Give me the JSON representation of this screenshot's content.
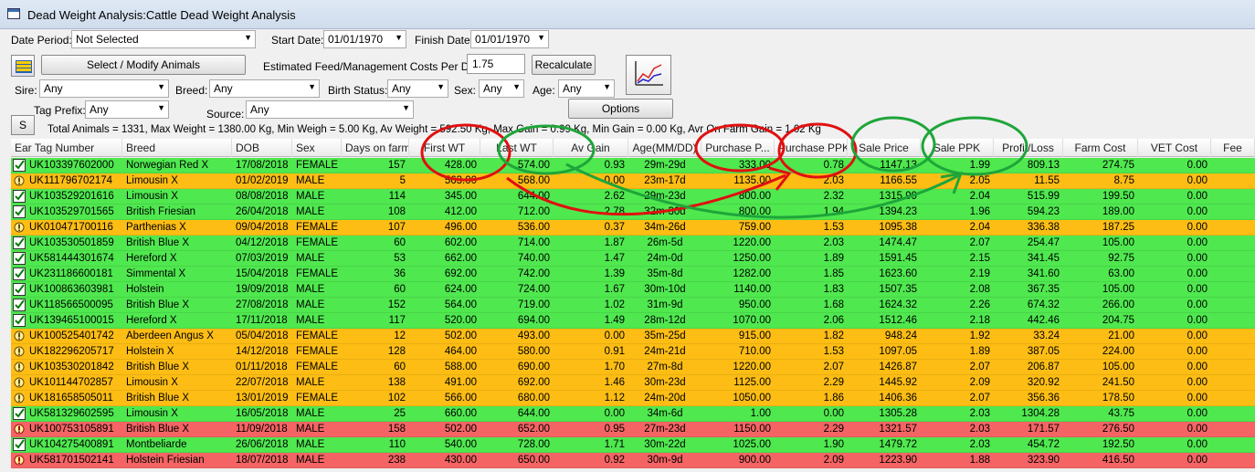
{
  "window": {
    "title": "Dead Weight Analysis:Cattle Dead Weight Analysis"
  },
  "filters": {
    "date_period_label": "Date Period:",
    "date_period": "Not Selected",
    "start_date_label": "Start Date:",
    "start_date": "01/01/1970",
    "finish_date_label": "Finish Date:",
    "finish_date": "01/01/1970",
    "select_animals_button": "Select / Modify Animals",
    "feed_cost_label": "Estimated Feed/Management Costs Per Day:",
    "feed_cost": "1.75",
    "recalculate_button": "Recalculate",
    "sire_label": "Sire:",
    "sire": "Any",
    "breed_label": "Breed:",
    "breed": "Any",
    "birth_status_label": "Birth Status:",
    "birth_status": "Any",
    "sex_label": "Sex:",
    "sex": "Any",
    "age_label": "Age:",
    "age": "Any",
    "tag_prefix_label": "Tag Prefix:",
    "tag_prefix": "Any",
    "source_label": "Source:",
    "source": "Any",
    "options_button": "Options",
    "s_button": "S"
  },
  "summary": "Total Animals = 1331, Max Weight = 1380.00 Kg, Min Weigh = 5.00 Kg, Av Weight = 592.50 Kg, Max Gain = 0.99 Kg, Min Gain = 0.00 Kg, Avr On Farm Gain = 1.02 Kg",
  "columns": [
    "Ear Tag Number",
    "Breed",
    "DOB",
    "Sex",
    "Days on farm",
    "First WT",
    "Last WT",
    "Av Gain",
    "Age(MM/DD)",
    "Purchase P...",
    "Purchase PPK",
    "Sale Price",
    "Sale PPK",
    "Profit/Loss",
    "Farm Cost",
    "VET Cost",
    "Fee"
  ],
  "colors": {
    "green": "#4fe84f",
    "orange": "#fdbd14",
    "red": "#f46464",
    "annotation_red": "#e01010",
    "annotation_green": "#1ea53a"
  },
  "rows": [
    {
      "status": "green",
      "tag": "UK103397602000",
      "breed": "Norwegian Red X",
      "dob": "17/08/2018",
      "sex": "FEMALE",
      "days": "157",
      "first": "428.00",
      "last": "574.00",
      "gain": "0.93",
      "age": "29m-29d",
      "pp": "333.00",
      "pppk": "0.78",
      "sp": "1147.13",
      "sppk": "1.99",
      "pl": "809.13",
      "farm": "274.75",
      "vet": "0.00"
    },
    {
      "status": "orange",
      "tag": "UK111796702174",
      "breed": "Limousin X",
      "dob": "01/02/2019",
      "sex": "MALE",
      "days": "5",
      "first": "563.00",
      "last": "568.00",
      "gain": "0.00",
      "age": "23m-17d",
      "pp": "1135.00",
      "pppk": "2.03",
      "sp": "1166.55",
      "sppk": "2.05",
      "pl": "11.55",
      "farm": "8.75",
      "vet": "0.00"
    },
    {
      "status": "green",
      "tag": "UK103529201616",
      "breed": "Limousin X",
      "dob": "08/08/2018",
      "sex": "MALE",
      "days": "114",
      "first": "345.00",
      "last": "644.00",
      "gain": "2.62",
      "age": "29m-23d",
      "pp": "800.00",
      "pppk": "2.32",
      "sp": "1315.99",
      "sppk": "2.04",
      "pl": "515.99",
      "farm": "199.50",
      "vet": "0.00"
    },
    {
      "status": "green",
      "tag": "UK103529701565",
      "breed": "British Friesian",
      "dob": "26/04/2018",
      "sex": "MALE",
      "days": "108",
      "first": "412.00",
      "last": "712.00",
      "gain": "2.78",
      "age": "32m-30d",
      "pp": "800.00",
      "pppk": "1.94",
      "sp": "1394.23",
      "sppk": "1.96",
      "pl": "594.23",
      "farm": "189.00",
      "vet": "0.00"
    },
    {
      "status": "orange",
      "tag": "UK010471700116",
      "breed": "Parthenias X",
      "dob": "09/04/2018",
      "sex": "FEMALE",
      "days": "107",
      "first": "496.00",
      "last": "536.00",
      "gain": "0.37",
      "age": "34m-26d",
      "pp": "759.00",
      "pppk": "1.53",
      "sp": "1095.38",
      "sppk": "2.04",
      "pl": "336.38",
      "farm": "187.25",
      "vet": "0.00"
    },
    {
      "status": "green",
      "tag": "UK103530501859",
      "breed": "British Blue X",
      "dob": "04/12/2018",
      "sex": "FEMALE",
      "days": "60",
      "first": "602.00",
      "last": "714.00",
      "gain": "1.87",
      "age": "26m-5d",
      "pp": "1220.00",
      "pppk": "2.03",
      "sp": "1474.47",
      "sppk": "2.07",
      "pl": "254.47",
      "farm": "105.00",
      "vet": "0.00"
    },
    {
      "status": "green",
      "tag": "UK581444301674",
      "breed": "Hereford X",
      "dob": "07/03/2019",
      "sex": "MALE",
      "days": "53",
      "first": "662.00",
      "last": "740.00",
      "gain": "1.47",
      "age": "24m-0d",
      "pp": "1250.00",
      "pppk": "1.89",
      "sp": "1591.45",
      "sppk": "2.15",
      "pl": "341.45",
      "farm": "92.75",
      "vet": "0.00"
    },
    {
      "status": "green",
      "tag": "UK231186600181",
      "breed": "Simmental X",
      "dob": "15/04/2018",
      "sex": "FEMALE",
      "days": "36",
      "first": "692.00",
      "last": "742.00",
      "gain": "1.39",
      "age": "35m-8d",
      "pp": "1282.00",
      "pppk": "1.85",
      "sp": "1623.60",
      "sppk": "2.19",
      "pl": "341.60",
      "farm": "63.00",
      "vet": "0.00"
    },
    {
      "status": "green",
      "tag": "UK100863603981",
      "breed": "Holstein",
      "dob": "19/09/2018",
      "sex": "MALE",
      "days": "60",
      "first": "624.00",
      "last": "724.00",
      "gain": "1.67",
      "age": "30m-10d",
      "pp": "1140.00",
      "pppk": "1.83",
      "sp": "1507.35",
      "sppk": "2.08",
      "pl": "367.35",
      "farm": "105.00",
      "vet": "0.00"
    },
    {
      "status": "green",
      "tag": "UK118566500095",
      "breed": "British Blue X",
      "dob": "27/08/2018",
      "sex": "MALE",
      "days": "152",
      "first": "564.00",
      "last": "719.00",
      "gain": "1.02",
      "age": "31m-9d",
      "pp": "950.00",
      "pppk": "1.68",
      "sp": "1624.32",
      "sppk": "2.26",
      "pl": "674.32",
      "farm": "266.00",
      "vet": "0.00"
    },
    {
      "status": "green",
      "tag": "UK139465100015",
      "breed": "Hereford X",
      "dob": "17/11/2018",
      "sex": "MALE",
      "days": "117",
      "first": "520.00",
      "last": "694.00",
      "gain": "1.49",
      "age": "28m-12d",
      "pp": "1070.00",
      "pppk": "2.06",
      "sp": "1512.46",
      "sppk": "2.18",
      "pl": "442.46",
      "farm": "204.75",
      "vet": "0.00"
    },
    {
      "status": "orange",
      "tag": "UK100525401742",
      "breed": "Aberdeen Angus X",
      "dob": "05/04/2018",
      "sex": "FEMALE",
      "days": "12",
      "first": "502.00",
      "last": "493.00",
      "gain": "0.00",
      "age": "35m-25d",
      "pp": "915.00",
      "pppk": "1.82",
      "sp": "948.24",
      "sppk": "1.92",
      "pl": "33.24",
      "farm": "21.00",
      "vet": "0.00"
    },
    {
      "status": "orange",
      "tag": "UK182296205717",
      "breed": "Holstein X",
      "dob": "14/12/2018",
      "sex": "FEMALE",
      "days": "128",
      "first": "464.00",
      "last": "580.00",
      "gain": "0.91",
      "age": "24m-21d",
      "pp": "710.00",
      "pppk": "1.53",
      "sp": "1097.05",
      "sppk": "1.89",
      "pl": "387.05",
      "farm": "224.00",
      "vet": "0.00"
    },
    {
      "status": "orange",
      "tag": "UK103530201842",
      "breed": "British Blue X",
      "dob": "01/11/2018",
      "sex": "FEMALE",
      "days": "60",
      "first": "588.00",
      "last": "690.00",
      "gain": "1.70",
      "age": "27m-8d",
      "pp": "1220.00",
      "pppk": "2.07",
      "sp": "1426.87",
      "sppk": "2.07",
      "pl": "206.87",
      "farm": "105.00",
      "vet": "0.00"
    },
    {
      "status": "orange",
      "tag": "UK101144702857",
      "breed": "Limousin X",
      "dob": "22/07/2018",
      "sex": "MALE",
      "days": "138",
      "first": "491.00",
      "last": "692.00",
      "gain": "1.46",
      "age": "30m-23d",
      "pp": "1125.00",
      "pppk": "2.29",
      "sp": "1445.92",
      "sppk": "2.09",
      "pl": "320.92",
      "farm": "241.50",
      "vet": "0.00"
    },
    {
      "status": "orange",
      "tag": "UK181658505011",
      "breed": "British Blue X",
      "dob": "13/01/2019",
      "sex": "FEMALE",
      "days": "102",
      "first": "566.00",
      "last": "680.00",
      "gain": "1.12",
      "age": "24m-20d",
      "pp": "1050.00",
      "pppk": "1.86",
      "sp": "1406.36",
      "sppk": "2.07",
      "pl": "356.36",
      "farm": "178.50",
      "vet": "0.00"
    },
    {
      "status": "green",
      "tag": "UK581329602595",
      "breed": "Limousin X",
      "dob": "16/05/2018",
      "sex": "MALE",
      "days": "25",
      "first": "660.00",
      "last": "644.00",
      "gain": "0.00",
      "age": "34m-6d",
      "pp": "1.00",
      "pppk": "0.00",
      "sp": "1305.28",
      "sppk": "2.03",
      "pl": "1304.28",
      "farm": "43.75",
      "vet": "0.00"
    },
    {
      "status": "red",
      "tag": "UK100753105891",
      "breed": "British Blue X",
      "dob": "11/09/2018",
      "sex": "MALE",
      "days": "158",
      "first": "502.00",
      "last": "652.00",
      "gain": "0.95",
      "age": "27m-23d",
      "pp": "1150.00",
      "pppk": "2.29",
      "sp": "1321.57",
      "sppk": "2.03",
      "pl": "171.57",
      "farm": "276.50",
      "vet": "0.00"
    },
    {
      "status": "green",
      "tag": "UK104275400891",
      "breed": "Montbeliarde",
      "dob": "26/06/2018",
      "sex": "MALE",
      "days": "110",
      "first": "540.00",
      "last": "728.00",
      "gain": "1.71",
      "age": "30m-22d",
      "pp": "1025.00",
      "pppk": "1.90",
      "sp": "1479.72",
      "sppk": "2.03",
      "pl": "454.72",
      "farm": "192.50",
      "vet": "0.00"
    },
    {
      "status": "red",
      "tag": "UK581701502141",
      "breed": "Holstein Friesian",
      "dob": "18/07/2018",
      "sex": "MALE",
      "days": "238",
      "first": "430.00",
      "last": "650.00",
      "gain": "0.92",
      "age": "30m-9d",
      "pp": "900.00",
      "pppk": "2.09",
      "sp": "1223.90",
      "sppk": "1.88",
      "pl": "323.90",
      "farm": "416.50",
      "vet": "0.00"
    }
  ]
}
